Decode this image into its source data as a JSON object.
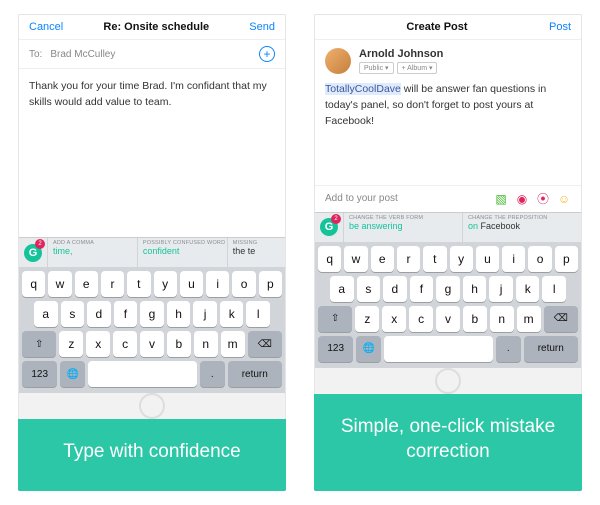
{
  "left": {
    "nav": {
      "cancel": "Cancel",
      "title": "Re: Onsite schedule",
      "send": "Send"
    },
    "to": {
      "label": "To:",
      "name": "Brad McCulley"
    },
    "body": "Thank you for your time Brad. I'm confidant that my skills would add value to team.",
    "badge": "2",
    "sugs": [
      {
        "t": "ADD A COMMA",
        "v": "time,",
        "plain": false
      },
      {
        "t": "POSSIBLY CONFUSED WORD",
        "v": "confident",
        "plain": false
      },
      {
        "t": "MISSING",
        "v": "the te",
        "plain": true
      }
    ],
    "caption": "Type with confidence"
  },
  "right": {
    "nav": {
      "cancel": "",
      "title": "Create Post",
      "send": "Post"
    },
    "poster": {
      "name": "Arnold Johnson",
      "p1": "Public ▾",
      "p2": "+ Album ▾"
    },
    "post": {
      "hl": "TotallyCoolDave",
      "rest": " will be answer fan questions in today's panel, so don't forget to post yours at Facebook!"
    },
    "addrow": "Add to your post",
    "badge": "2",
    "sugs": [
      {
        "t": "CHANGE THE VERB FORM",
        "v": "be answering",
        "plain": false
      },
      {
        "t": "CHANGE THE PREPOSITION",
        "v": "on Facebook",
        "plain": false,
        "pre": "on "
      }
    ],
    "caption": "Simple, one-click mistake correction"
  },
  "rows": {
    "r1": [
      "q",
      "w",
      "e",
      "r",
      "t",
      "y",
      "u",
      "i",
      "o",
      "p"
    ],
    "r2": [
      "a",
      "s",
      "d",
      "f",
      "g",
      "h",
      "j",
      "k",
      "l"
    ],
    "r3": [
      "z",
      "x",
      "c",
      "v",
      "b",
      "n",
      "m"
    ],
    "num": "123",
    "ret": "return"
  }
}
